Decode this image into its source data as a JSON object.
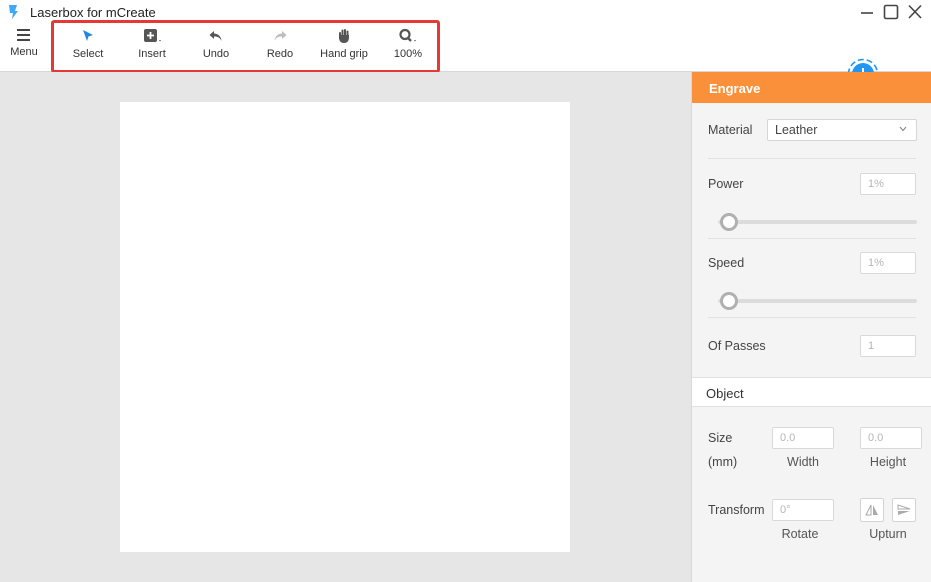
{
  "app": {
    "title": "Laserbox for mCreate"
  },
  "toolbar": {
    "menu_label": "Menu",
    "select_label": "Select",
    "insert_label": "Insert",
    "undo_label": "Undo",
    "redo_label": "Redo",
    "hand_label": "Hand grip",
    "zoom_label": "100%"
  },
  "icons": {
    "menu": "hamburger-icon",
    "select": "cursor-arrow-icon",
    "insert": "insert-plus-icon",
    "undo": "undo-arrow-icon",
    "redo": "redo-arrow-icon",
    "hand": "hand-grip-icon",
    "zoom": "zoom-magnifier-icon",
    "add_device": "add-device-icon"
  },
  "colors": {
    "accent_orange": "#fa913a",
    "accent_blue": "#2196f3",
    "highlight_red": "#e53935",
    "select_icon_blue": "#1e88e5"
  },
  "engrave": {
    "header": "Engrave",
    "material_label": "Material",
    "material_value": "Leather",
    "power_label": "Power",
    "power_value": "1%",
    "power_level": 0.01,
    "speed_label": "Speed",
    "speed_value": "1%",
    "speed_level": 0.01,
    "passes_label": "Of Passes",
    "passes_value": "1"
  },
  "object": {
    "header": "Object",
    "size_label": "Size",
    "size_unit": "(mm)",
    "width_value": "0.0",
    "height_value": "0.0",
    "width_label": "Width",
    "height_label": "Height",
    "transform_label": "Transform",
    "rotate_value": "0°",
    "rotate_label": "Rotate",
    "upturn_label": "Upturn"
  }
}
